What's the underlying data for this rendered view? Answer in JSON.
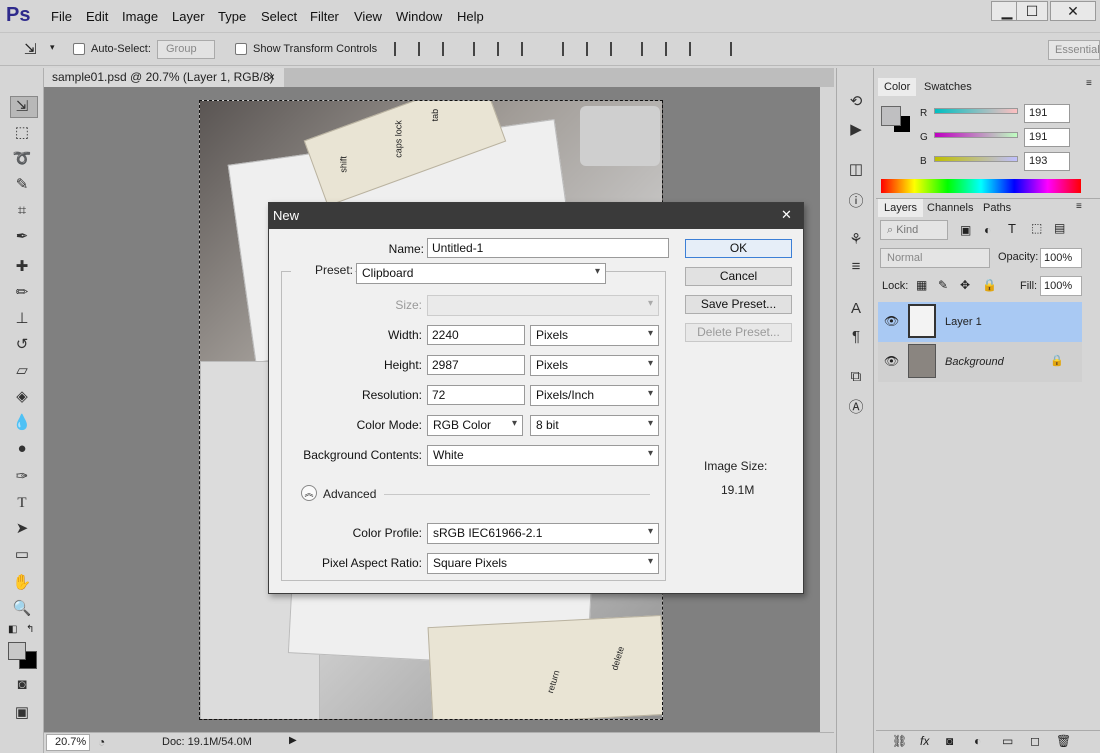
{
  "app": {
    "logo": "Ps"
  },
  "menu": [
    "File",
    "Edit",
    "Image",
    "Layer",
    "Type",
    "Select",
    "Filter",
    "View",
    "Window",
    "Help"
  ],
  "window_controls": {
    "minimize": "▁",
    "maximize": "☐",
    "close": "✕"
  },
  "options": {
    "auto_select_label": "Auto-Select:",
    "group_value": "Group",
    "show_transform_label": "Show Transform Controls",
    "workspace": "Essential"
  },
  "document": {
    "tab_label": "sample01.psd @ 20.7% (Layer 1, RGB/8)",
    "tab_close": "×",
    "zoom": "20.7%",
    "doc_info": "Doc: 19.1M/54.0M",
    "photo_key_labels": [
      "shift",
      "caps lock",
      "tab",
      "return",
      "delete"
    ]
  },
  "color_panel": {
    "tabs": [
      "Color",
      "Swatches"
    ],
    "labels": [
      "R",
      "G",
      "B"
    ],
    "values": [
      "191",
      "191",
      "193"
    ]
  },
  "layers_panel": {
    "tabs": [
      "Layers",
      "Channels",
      "Paths"
    ],
    "kind": "Kind",
    "blend_mode": "Normal",
    "opacity_label": "Opacity:",
    "opacity": "100%",
    "lock_label": "Lock:",
    "fill_label": "Fill:",
    "fill": "100%",
    "layers": [
      {
        "name": "Layer 1"
      },
      {
        "name": "Background"
      }
    ]
  },
  "dialog": {
    "title": "New",
    "close": "✕",
    "name_label": "Name:",
    "name_value": "Untitled-1",
    "preset_label": "Preset:",
    "preset_value": "Clipboard",
    "size_label": "Size:",
    "width_label": "Width:",
    "width_value": "2240",
    "width_unit": "Pixels",
    "height_label": "Height:",
    "height_value": "2987",
    "height_unit": "Pixels",
    "resolution_label": "Resolution:",
    "resolution_value": "72",
    "resolution_unit": "Pixels/Inch",
    "color_mode_label": "Color Mode:",
    "color_mode_value": "RGB Color",
    "bit_depth": "8 bit",
    "bg_label": "Background Contents:",
    "bg_value": "White",
    "advanced_label": "Advanced",
    "profile_label": "Color Profile:",
    "profile_value": "sRGB IEC61966-2.1",
    "par_label": "Pixel Aspect Ratio:",
    "par_value": "Square Pixels",
    "ok": "OK",
    "cancel": "Cancel",
    "save_preset": "Save Preset...",
    "delete_preset": "Delete Preset...",
    "image_size_label": "Image Size:",
    "image_size_value": "19.1M"
  }
}
